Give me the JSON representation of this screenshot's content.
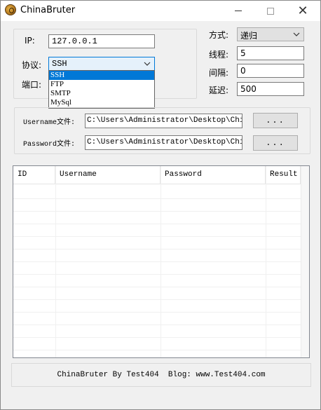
{
  "window": {
    "title": "ChinaBruter",
    "minimize_icon": "minimize-icon",
    "maximize_icon": "maximize-icon",
    "close_icon": "close-icon",
    "close_glyph": "✕"
  },
  "target": {
    "ip_label": "IP:",
    "ip_value": "127.0.0.1",
    "protocol_label": "协议:",
    "protocol_selected": "SSH",
    "protocol_options": [
      "SSH",
      "FTP",
      "SMTP",
      "MySql"
    ],
    "port_label": "端口:"
  },
  "settings": {
    "mode_label": "方式:",
    "mode_value": "递归",
    "threads_label": "线程:",
    "threads_value": "5",
    "interval_label": "间隔:",
    "interval_value": "0",
    "delay_label": "延迟:",
    "delay_value": "500"
  },
  "files": {
    "username_label": "Username文件:",
    "username_path": "C:\\Users\\Administrator\\Desktop\\ChinaB",
    "password_label": "Password文件:",
    "password_path": "C:\\Users\\Administrator\\Desktop\\ChinaB",
    "browse_label": "..."
  },
  "results": {
    "columns": [
      "ID",
      "Username",
      "Password",
      "Result"
    ]
  },
  "footer": {
    "text": "ChinaBruter By Test404  Blog: www.Test404.com"
  },
  "colors": {
    "accent": "#0078d7",
    "window_bg": "#f0f0f0"
  }
}
